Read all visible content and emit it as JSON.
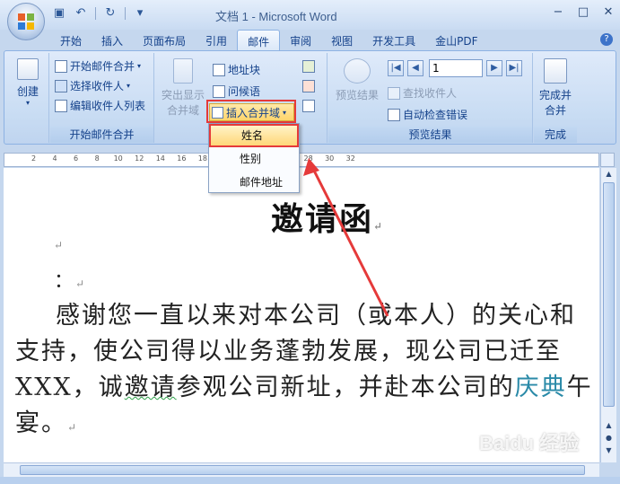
{
  "window": {
    "title": "文档 1 - Microsoft Word",
    "controls": [
      "−",
      "□",
      "✕"
    ]
  },
  "quick_access": [
    "save-icon",
    "undo-icon",
    "redo-icon",
    "customize-icon"
  ],
  "tabs": [
    {
      "label": "开始"
    },
    {
      "label": "插入"
    },
    {
      "label": "页面布局"
    },
    {
      "label": "引用"
    },
    {
      "label": "邮件",
      "active": true
    },
    {
      "label": "审阅"
    },
    {
      "label": "视图"
    },
    {
      "label": "开发工具"
    },
    {
      "label": "金山PDF"
    }
  ],
  "ribbon": {
    "create": {
      "label": "创建"
    },
    "start_merge": {
      "start": "开始邮件合并",
      "select": "选择收件人",
      "edit": "编辑收件人列表",
      "group_label": "开始邮件合并"
    },
    "write_insert": {
      "highlight": "突出显示\n合并域",
      "highlight_l1": "突出显示",
      "highlight_l2": "合并域",
      "address": "地址块",
      "greeting": "问候语",
      "insert_field": "插入合并域"
    },
    "preview": {
      "preview_results": "预览结果",
      "record": "1",
      "find": "查找收件人",
      "auto_check": "自动检查错误",
      "group_label": "预览结果"
    },
    "finish": {
      "finish_l1": "完成并",
      "finish_l2": "合并",
      "group_label": "完成"
    }
  },
  "dropdown": {
    "items": [
      "姓名",
      "性别",
      "邮件地址"
    ],
    "selected": "姓名"
  },
  "ruler": [
    "2",
    "4",
    "6",
    "8",
    "10",
    "12",
    "14",
    "16",
    "18",
    "20",
    "22",
    "24",
    "26",
    "28",
    "30",
    "32"
  ],
  "document": {
    "title": "邀请函",
    "colon_line": "：",
    "line1": "感谢您一直以来对本公司（或本人）的关心和",
    "line2": "支持，使公司得以业务蓬勃发展，现公司已迁至",
    "line3_a": "XXX，诚",
    "line3_b": "邀请",
    "line3_c": "参观公司新址，并赴本公司的",
    "line3_d": "庆典",
    "line3_e": "午",
    "line4": "宴。",
    "para_mark": "↵"
  },
  "watermark": "Baidu 经验",
  "colors": {
    "highlight_red": "#e53a3a",
    "accent_blue": "#15428b",
    "ribbon_bg": "#c8dcf3"
  }
}
